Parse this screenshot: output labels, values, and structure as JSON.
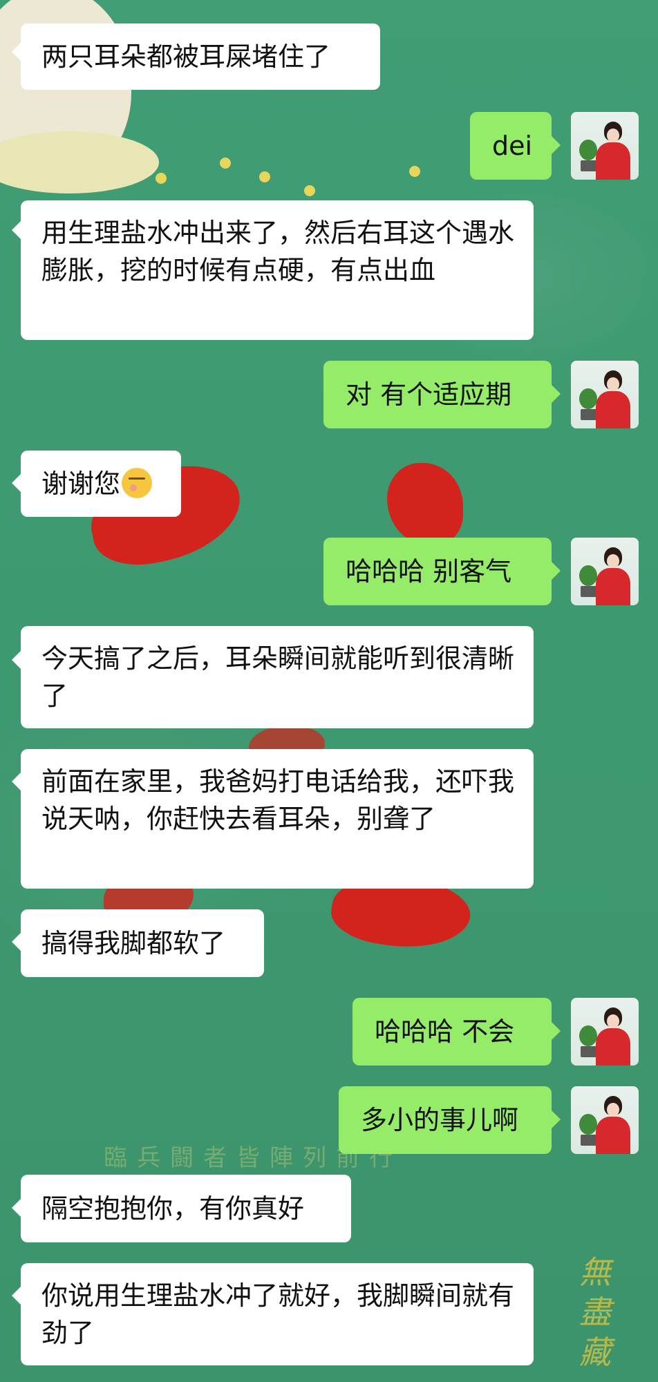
{
  "chat": {
    "messages": [
      {
        "side": "left",
        "text": "两只耳朵都被耳屎堵住了"
      },
      {
        "side": "right",
        "text": "dei"
      },
      {
        "side": "left",
        "text": "用生理盐水冲出来了，然后右耳这个遇水膨胀，挖的时候有点硬，有点出血"
      },
      {
        "side": "right",
        "text": "对  有个适应期"
      },
      {
        "side": "left",
        "text": "谢谢您",
        "emoji": "kissing-face-emoji"
      },
      {
        "side": "right",
        "text": "哈哈哈  别客气"
      },
      {
        "side": "left",
        "text": "今天搞了之后，耳朵瞬间就能听到很清晰了"
      },
      {
        "side": "left",
        "text": "前面在家里，我爸妈打电话给我，还吓我说天呐，你赶快去看耳朵，别聋了"
      },
      {
        "side": "left",
        "text": "搞得我脚都软了"
      },
      {
        "side": "right",
        "text": "哈哈哈  不会"
      },
      {
        "side": "right",
        "text": "多小的事儿啊"
      },
      {
        "side": "left",
        "text": "隔空抱抱你，有你真好"
      },
      {
        "side": "left",
        "text": "你说用生理盐水冲了就好，我脚瞬间就有劲了"
      }
    ]
  },
  "background": {
    "watermark_text": "臨兵闘者皆陣列前行",
    "stamp_text": "無盡藏"
  },
  "colors": {
    "chat_background": "#3f9a72",
    "incoming_bubble": "#ffffff",
    "outgoing_bubble": "#95ec69",
    "accent_red": "#d2231c"
  }
}
